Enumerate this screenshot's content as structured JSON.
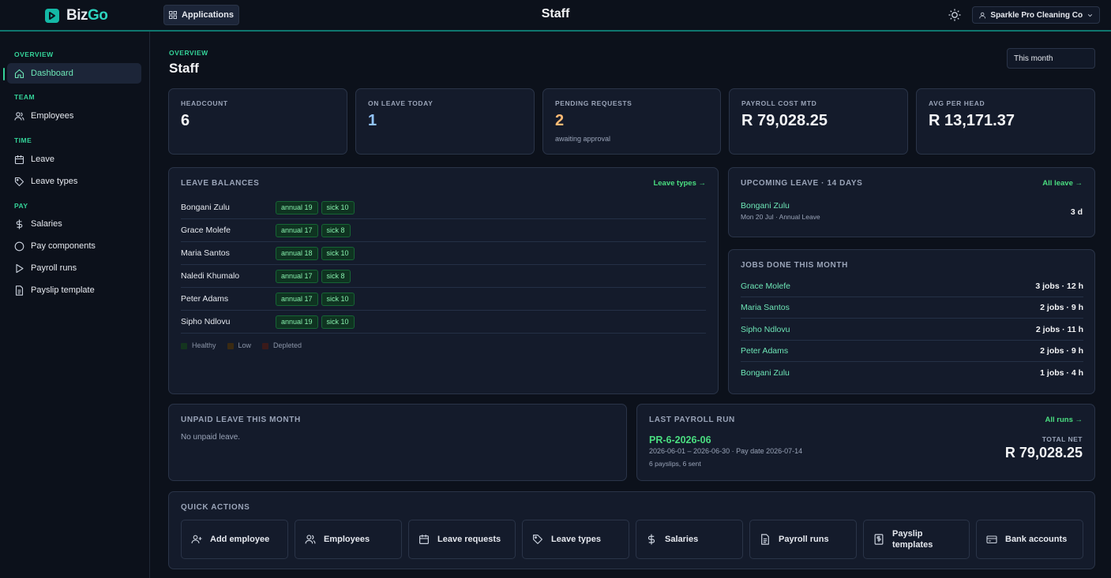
{
  "app": {
    "logo_prefix": "Biz",
    "logo_suffix": "Go",
    "apps_label": "Applications",
    "title": "Staff",
    "company": "Sparkle Pro Cleaning Co"
  },
  "sidebar": {
    "sections": [
      "OVERVIEW",
      "TEAM",
      "TIME",
      "PAY"
    ],
    "items": [
      {
        "label": "Dashboard",
        "icon": "home-icon"
      },
      {
        "label": "Employees",
        "icon": "users-icon"
      },
      {
        "label": "Leave",
        "icon": "calendar-icon"
      },
      {
        "label": "Leave types",
        "icon": "tag-icon"
      },
      {
        "label": "Salaries",
        "icon": "dollar-icon"
      },
      {
        "label": "Pay components",
        "icon": "circle-icon"
      },
      {
        "label": "Payroll runs",
        "icon": "play-icon"
      },
      {
        "label": "Payslip template",
        "icon": "document-icon"
      }
    ]
  },
  "header": {
    "eyebrow": "OVERVIEW",
    "title": "Staff",
    "period": "This month"
  },
  "stats": [
    {
      "label": "HEADCOUNT",
      "value": "6",
      "sub": "",
      "color": "#f3f4f6"
    },
    {
      "label": "ON LEAVE TODAY",
      "value": "1",
      "sub": "",
      "color": "#93c5fd"
    },
    {
      "label": "PENDING REQUESTS",
      "value": "2",
      "sub": "awaiting approval",
      "color": "#fdba74"
    },
    {
      "label": "PAYROLL COST MTD",
      "value": "R 79,028.25",
      "sub": "",
      "color": "#f3f4f6"
    },
    {
      "label": "AVG PER HEAD",
      "value": "R 13,171.37",
      "sub": "",
      "color": "#f3f4f6"
    }
  ],
  "leave_balances": {
    "title": "LEAVE BALANCES",
    "link": "Leave types →",
    "rows": [
      {
        "name": "Bongani Zulu",
        "annual": "annual 19",
        "sick": "sick 10"
      },
      {
        "name": "Grace Molefe",
        "annual": "annual 17",
        "sick": "sick 8"
      },
      {
        "name": "Maria Santos",
        "annual": "annual 18",
        "sick": "sick 10"
      },
      {
        "name": "Naledi Khumalo",
        "annual": "annual 17",
        "sick": "sick 8"
      },
      {
        "name": "Peter Adams",
        "annual": "annual 17",
        "sick": "sick 10"
      },
      {
        "name": "Sipho Ndlovu",
        "annual": "annual 19",
        "sick": "sick 10"
      }
    ],
    "legend": [
      "Healthy",
      "Low",
      "Depleted"
    ]
  },
  "upcoming_leave": {
    "title": "UPCOMING LEAVE · 14 DAYS",
    "link": "All leave →",
    "name": "Bongani Zulu",
    "detail": "Mon 20 Jul · Annual Leave",
    "days": "3 d"
  },
  "jobs": {
    "title": "JOBS DONE THIS MONTH",
    "rows": [
      {
        "name": "Grace Molefe",
        "value": "3 jobs · 12 h"
      },
      {
        "name": "Maria Santos",
        "value": "2 jobs · 9 h"
      },
      {
        "name": "Sipho Ndlovu",
        "value": "2 jobs · 11 h"
      },
      {
        "name": "Peter Adams",
        "value": "2 jobs · 9 h"
      },
      {
        "name": "Bongani Zulu",
        "value": "1 jobs · 4 h"
      }
    ]
  },
  "unpaid": {
    "title": "UNPAID LEAVE THIS MONTH",
    "empty": "No unpaid leave."
  },
  "payroll": {
    "title": "LAST PAYROLL RUN",
    "link": "All runs →",
    "id": "PR-6-2026-06",
    "dates": "2026-06-01 – 2026-06-30 · Pay date 2026-07-14",
    "slips": "6 payslips, 6 sent",
    "total_label": "TOTAL NET",
    "total": "R 79,028.25"
  },
  "quick_actions": {
    "title": "QUICK ACTIONS",
    "items": [
      {
        "label": "Add employee",
        "icon": "user-plus-icon"
      },
      {
        "label": "Employees",
        "icon": "users-icon"
      },
      {
        "label": "Leave requests",
        "icon": "calendar-icon"
      },
      {
        "label": "Leave types",
        "icon": "tag-icon"
      },
      {
        "label": "Salaries",
        "icon": "dollar-icon"
      },
      {
        "label": "Payroll runs",
        "icon": "file-icon"
      },
      {
        "label": "Payslip templates",
        "icon": "receipt-icon"
      },
      {
        "label": "Bank accounts",
        "icon": "card-icon"
      }
    ]
  }
}
